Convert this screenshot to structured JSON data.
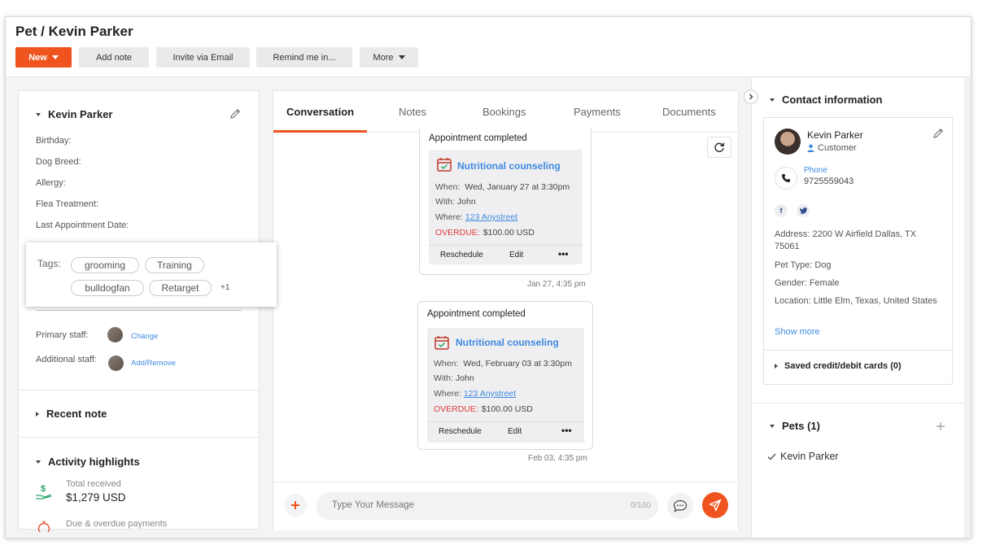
{
  "header": {
    "title": "Pet / Kevin Parker",
    "buttons": {
      "new": "New",
      "add_note": "Add note",
      "invite": "Invite via Email",
      "remind": "Remind me in...",
      "more": "More"
    }
  },
  "left": {
    "name": "Kevin Parker",
    "fields": [
      "Birthday:",
      "Dog Breed:",
      "Allergy:",
      "Flea Treatment:",
      "Last Appointment Date:"
    ],
    "tags_label": "Tags:",
    "tags": [
      "grooming",
      "Training",
      "bulldogfan",
      "Retarget"
    ],
    "tags_more": "+1",
    "primary_staff_label": "Primary staff:",
    "primary_staff_action": "Change",
    "additional_staff_label": "Additional staff:",
    "additional_staff_action": "Add/Remove",
    "recent_note": "Recent note",
    "activity_title": "Activity highlights",
    "total_received_label": "Total received",
    "total_received_value": "$1,279 USD",
    "due_label": "Due & overdue payments"
  },
  "conversation": {
    "tabs": [
      "Conversation",
      "Notes",
      "Bookings",
      "Payments",
      "Documents"
    ],
    "active_tab": "Conversation",
    "appointments": [
      {
        "heading": "Appointment completed",
        "service": "Nutritional counseling",
        "when_label": "When:",
        "when": "Wed, January 27 at 3:30pm",
        "with_label": "With:",
        "with": "John",
        "where_label": "Where:",
        "where": "123 Anystreet",
        "overdue_label": "OVERDUE:",
        "amount": "$100.00 USD",
        "reschedule": "Reschedule",
        "edit": "Edit",
        "more": "•••",
        "timestamp": "Jan 27, 4:35 pm"
      },
      {
        "heading": "Appointment completed",
        "service": "Nutritional counseling",
        "when_label": "When:",
        "when": "Wed, February 03 at 3:30pm",
        "with_label": "With:",
        "with": "John",
        "where_label": "Where:",
        "where": "123 Anystreet",
        "overdue_label": "OVERDUE:",
        "amount": "$100.00 USD",
        "reschedule": "Reschedule",
        "edit": "Edit",
        "more": "•••",
        "timestamp": "Feb 03, 4:35 pm"
      }
    ],
    "composer": {
      "placeholder": "Type Your Message",
      "counter": "0/160"
    }
  },
  "contact": {
    "title": "Contact information",
    "name": "Kevin Parker",
    "role": "Customer",
    "phone_label": "Phone",
    "phone": "9725559043",
    "address_label": "Address:",
    "address": "2200 W Airfield Dallas, TX 75061",
    "pet_type_label": "Pet Type:",
    "pet_type": "Dog",
    "gender_label": "Gender:",
    "gender": "Female",
    "location_label": "Location:",
    "location": "Little Elm, Texas, United States",
    "show_more": "Show more",
    "saved_cards": "Saved credit/debit cards (0)",
    "pets_title": "Pets (1)",
    "pet_name": "Kevin Parker"
  },
  "colors": {
    "accent": "#f0541e",
    "link": "#3f8ae0",
    "overdue": "#e03b3b"
  }
}
